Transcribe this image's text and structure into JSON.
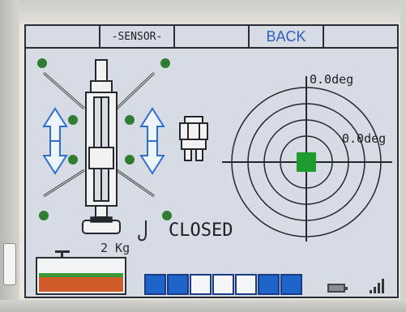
{
  "softkeys": [
    "",
    "-SENSOR-",
    "",
    "BACK",
    ""
  ],
  "colors": {
    "accent": "#2f5dc2",
    "sensor_green": "#2e7d32",
    "target_green": "#1f9a2f",
    "arrow_blue": "#2f6ed0",
    "segment_on": "#1f64c8"
  },
  "readouts": {
    "deg_top": "0.0deg",
    "deg_right": "0.0deg",
    "weight": "2 Kg",
    "hook_status": "CLOSED"
  },
  "gauge": {
    "segments": [
      "on",
      "on",
      "off",
      "off",
      "off",
      "on",
      "on"
    ]
  },
  "icons": [
    "sensor-dot-icon",
    "boom-icon",
    "hook-icon",
    "tank-icon",
    "battery-icon",
    "signal-icon",
    "outrigger-arrow-icon",
    "crane-unit-icon"
  ]
}
